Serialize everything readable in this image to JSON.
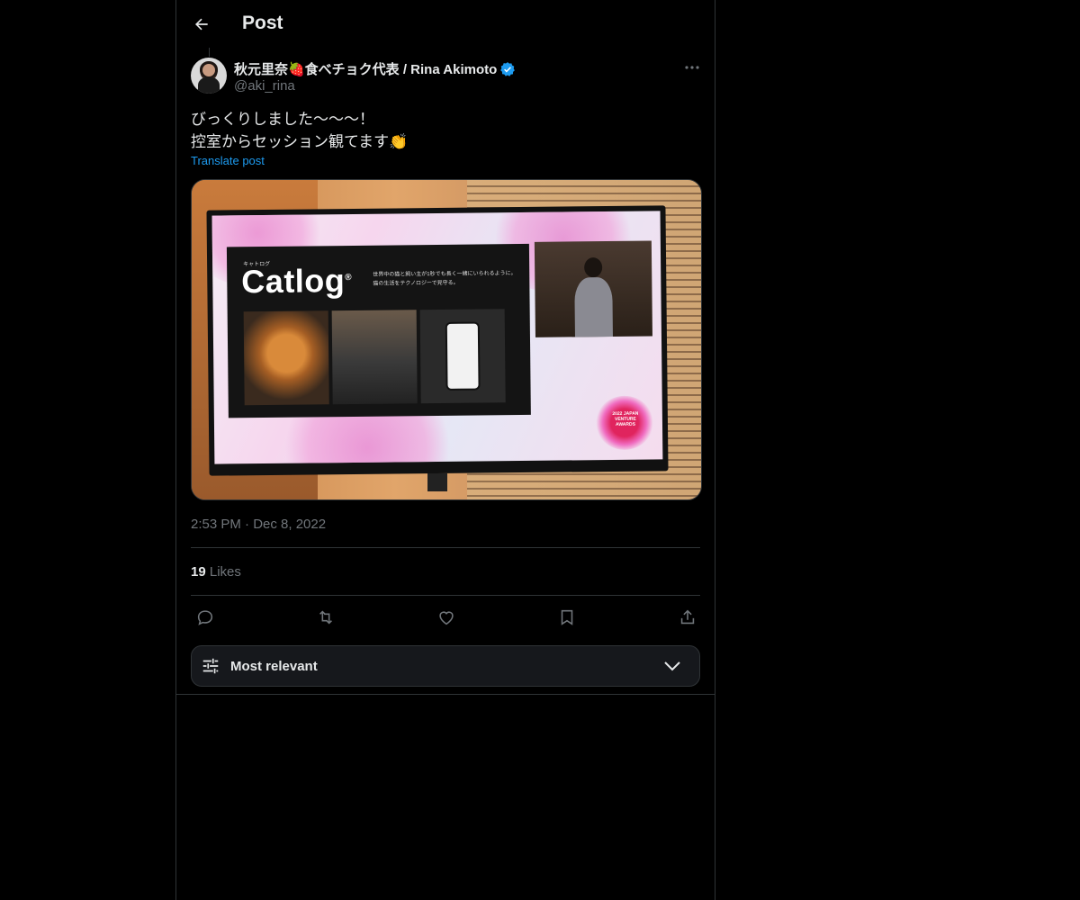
{
  "header": {
    "title": "Post",
    "back_icon": "arrow-left-icon"
  },
  "author": {
    "display_name": "秋元里奈🍓食べチョク代表 / Rina Akimoto",
    "handle": "@aki_rina",
    "verified": true,
    "verified_color": "#1d9bf0"
  },
  "tweet": {
    "text": "びっくりしました〜〜〜！\n控室からセッション観てます👏",
    "translate_label": "Translate post",
    "timestamp": "2:53 PM · Dec 8, 2022"
  },
  "media": {
    "slide_kana": "キャトログ",
    "slide_logo": "Catlog",
    "slide_tagline": "世界中の猫と飼い主が1秒でも長く一緒にいられるように。猫の生活をテクノロジーで見守る。",
    "award_text": "2022 JAPAN VENTURE AWARDS"
  },
  "stats": {
    "likes_count": "19",
    "likes_label": "Likes"
  },
  "actions": {
    "reply_icon": "reply-icon",
    "repost_icon": "repost-icon",
    "like_icon": "heart-icon",
    "bookmark_icon": "bookmark-icon",
    "share_icon": "share-icon"
  },
  "sort": {
    "label": "Most relevant"
  },
  "colors": {
    "background": "#000000",
    "text": "#e7e9ea",
    "muted": "#71767b",
    "accent": "#1d9bf0",
    "border": "#2f3336"
  }
}
